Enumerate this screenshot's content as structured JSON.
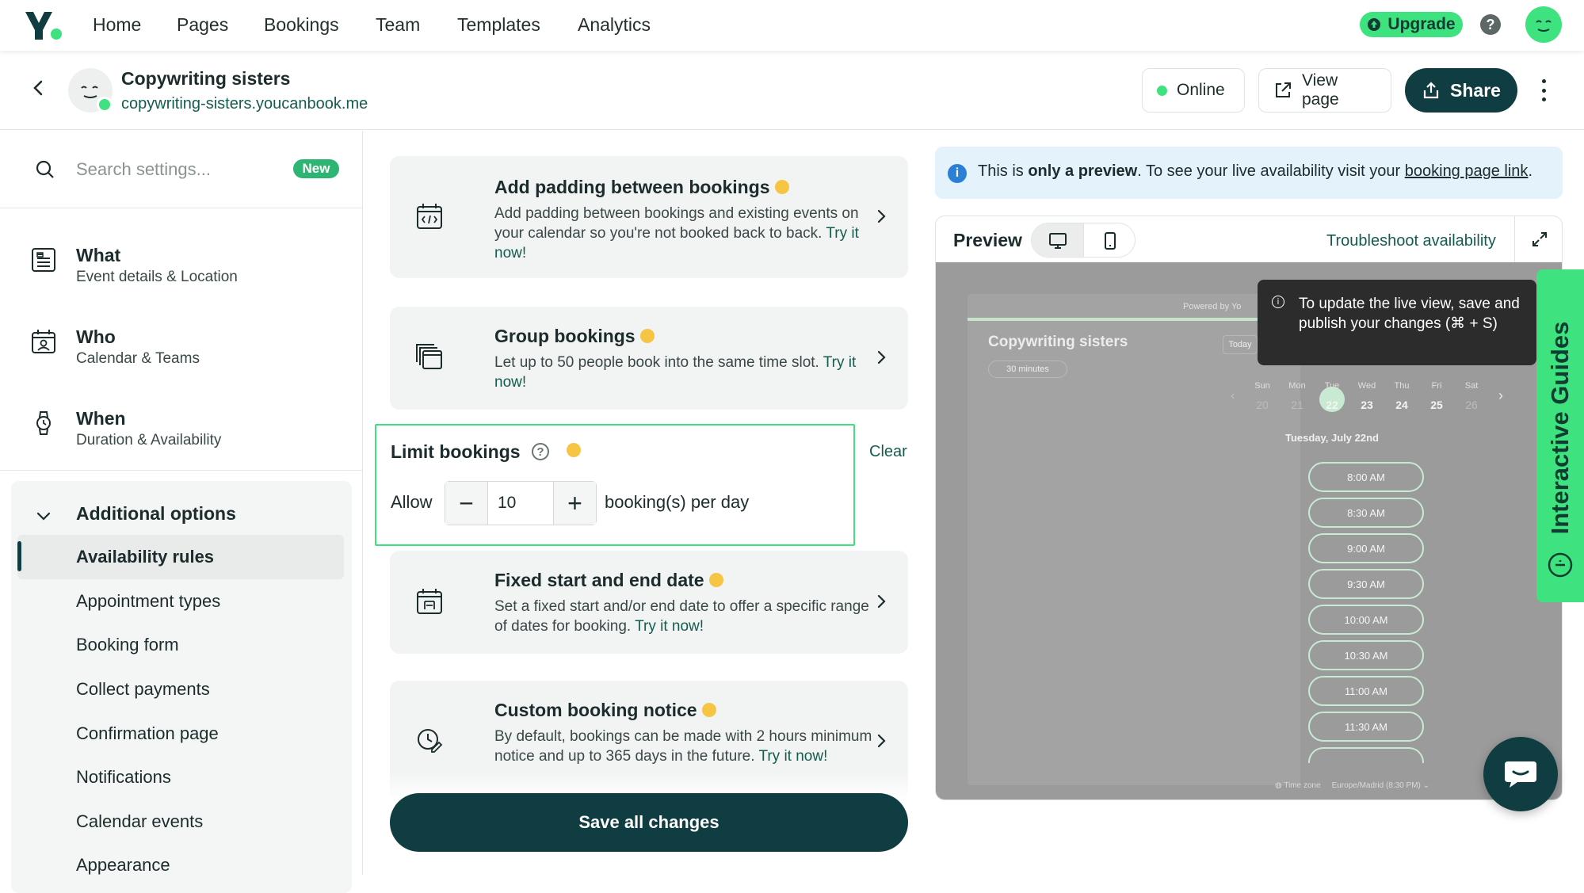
{
  "nav": {
    "links": [
      "Home",
      "Pages",
      "Bookings",
      "Team",
      "Templates",
      "Analytics"
    ],
    "upgrade_label": "Upgrade",
    "help_label": "?"
  },
  "header": {
    "title": "Copywriting sisters",
    "url": "copywriting-sisters.youcanbook.me",
    "online_label": "Online",
    "view_page_label": "View page",
    "share_label": "Share"
  },
  "sidebar": {
    "search_placeholder": "Search settings...",
    "new_badge": "New",
    "groups": [
      {
        "title": "What",
        "subtitle": "Event details & Location"
      },
      {
        "title": "Who",
        "subtitle": "Calendar & Teams"
      },
      {
        "title": "When",
        "subtitle": "Duration & Availability"
      }
    ],
    "additional_title": "Additional options",
    "options": [
      "Availability rules",
      "Appointment types",
      "Booking form",
      "Collect payments",
      "Confirmation page",
      "Notifications",
      "Calendar events",
      "Appearance"
    ],
    "active_option": "Availability rules"
  },
  "main": {
    "cards": [
      {
        "title": "Add padding between bookings",
        "desc": "Add padding between bookings and existing events on your calendar so you're not booked back to back.",
        "try": "Try it now!"
      },
      {
        "title": "Group bookings",
        "desc": "Let up to 50 people book into the same time slot.",
        "try": "Try it now!"
      },
      {
        "title": "Fixed start and end date",
        "desc": "Set a fixed start and/or end date to offer a specific range of dates for booking.",
        "try": "Try it now!"
      },
      {
        "title": "Custom booking notice",
        "desc": "By default, bookings can be made with 2 hours minimum notice and up to 365 days in the future.",
        "try": "Try it now!"
      }
    ],
    "limit": {
      "title": "Limit bookings",
      "allow_label": "Allow",
      "value": "10",
      "unit_label": "booking(s) per day",
      "clear_label": "Clear",
      "minus": "−",
      "plus": "+"
    },
    "save_label": "Save all changes"
  },
  "preview": {
    "info_prefix": "This is ",
    "info_bold": "only a preview",
    "info_middle": ". To see your live availability visit your ",
    "info_link": "booking page link",
    "info_suffix": ".",
    "title": "Preview",
    "troubleshoot_label": "Troubleshoot availability",
    "tooltip": "To update the live view, save and publish your changes (⌘ + S)",
    "tooltip_icon": "i",
    "page": {
      "powered_by": "Powered by Yo",
      "name": "Copywriting sisters",
      "duration": "30 minutes",
      "today_label": "Today",
      "days": [
        "Sun",
        "Mon",
        "Tue",
        "Wed",
        "Thu",
        "Fri",
        "Sat"
      ],
      "dates": [
        "20",
        "21",
        "22",
        "23",
        "24",
        "25",
        "26"
      ],
      "selected_date": "Tuesday, July 22nd",
      "slots": [
        "8:00 AM",
        "8:30 AM",
        "9:00 AM",
        "9:30 AM",
        "10:00 AM",
        "10:30 AM",
        "11:00 AM",
        "11:30 AM"
      ],
      "timezone_label": "Time zone",
      "timezone_value": "Europe/Madrid (8:30 PM)"
    }
  },
  "guides_label": "Interactive Guides",
  "colors": {
    "brand_green": "#3ee27e",
    "primary_dark": "#0f3d41",
    "link_teal": "#145c4f",
    "highlight_border": "#3ee27e"
  }
}
